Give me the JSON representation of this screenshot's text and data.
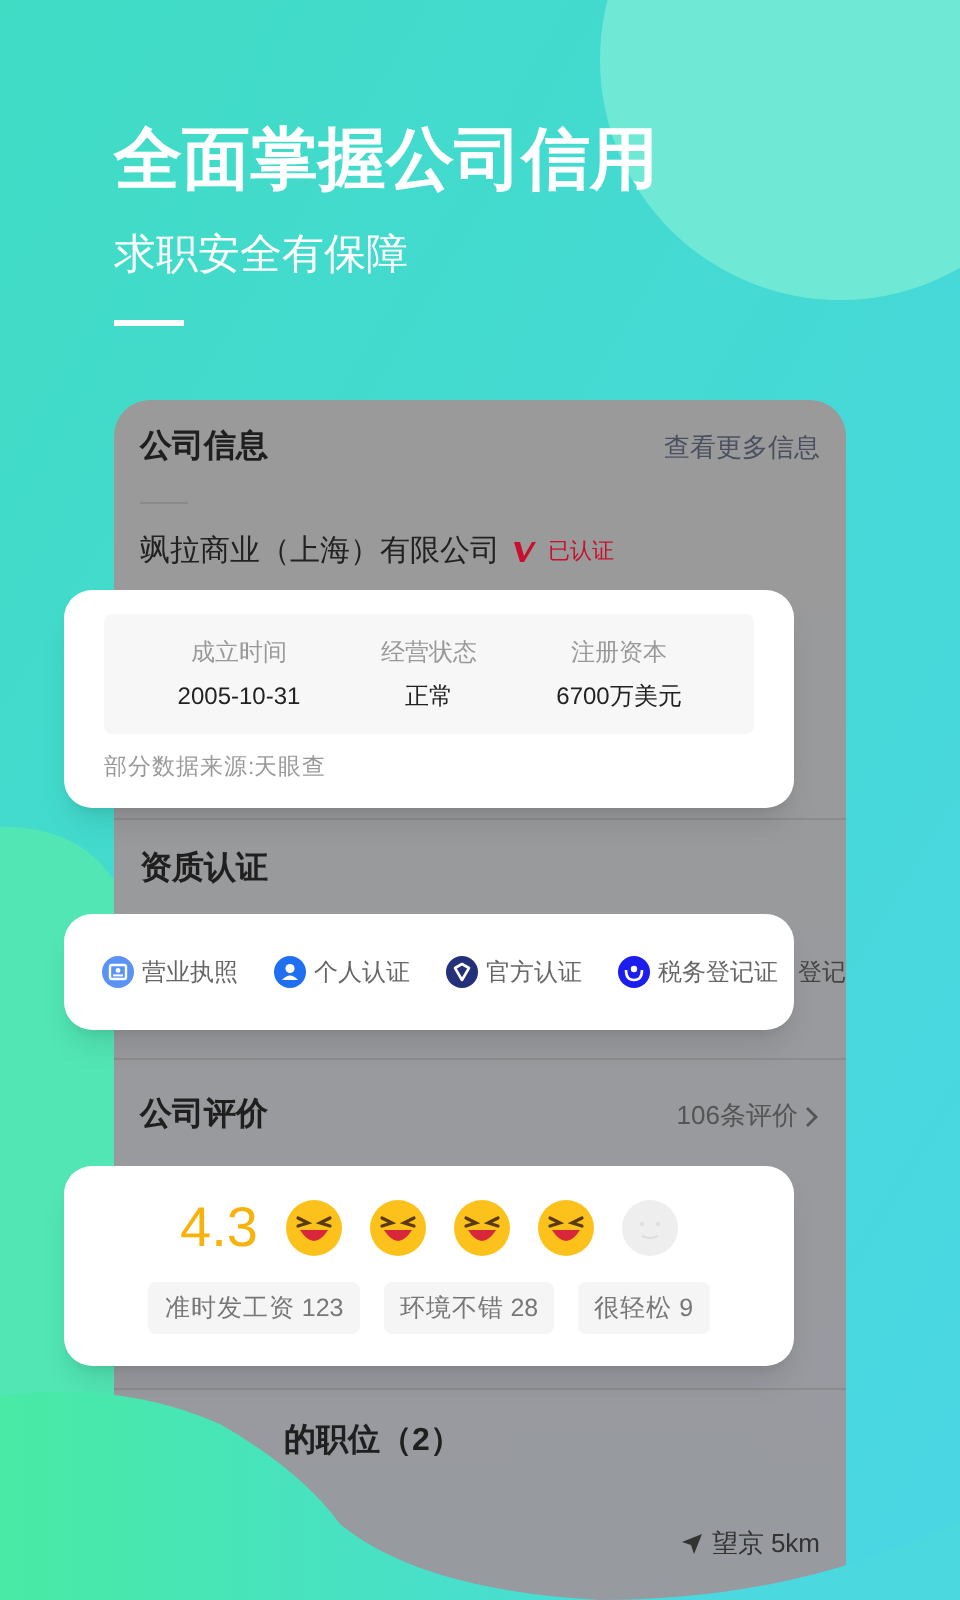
{
  "headline": "全面掌握公司信用",
  "subheadline": "求职安全有保障",
  "company_info": {
    "title": "公司信息",
    "more_link": "查看更多信息",
    "company_name": "飒拉商业（上海）有限公司",
    "verified_badge": "已认证",
    "facts": [
      {
        "label": "成立时间",
        "value": "2005-10-31"
      },
      {
        "label": "经营状态",
        "value": "正常"
      },
      {
        "label": "注册资本",
        "value": "6700万美元"
      }
    ],
    "source_note": "部分数据来源:天眼查"
  },
  "qualifications": {
    "title": "资质认证",
    "covered_text": "登记",
    "items": [
      {
        "kind": "license",
        "label": "营业执照"
      },
      {
        "kind": "person",
        "label": "个人认证"
      },
      {
        "kind": "official",
        "label": "官方认证"
      },
      {
        "kind": "tax",
        "label": "税务登记证"
      }
    ]
  },
  "reviews": {
    "title": "公司评价",
    "count_link": "106条评价",
    "score": "4.3",
    "stars": 4,
    "tags": [
      "准时发工资 123",
      "环境不错 28",
      "很轻松 9"
    ]
  },
  "jobs": {
    "title": "的职位（2）",
    "location": "望京 5km"
  }
}
